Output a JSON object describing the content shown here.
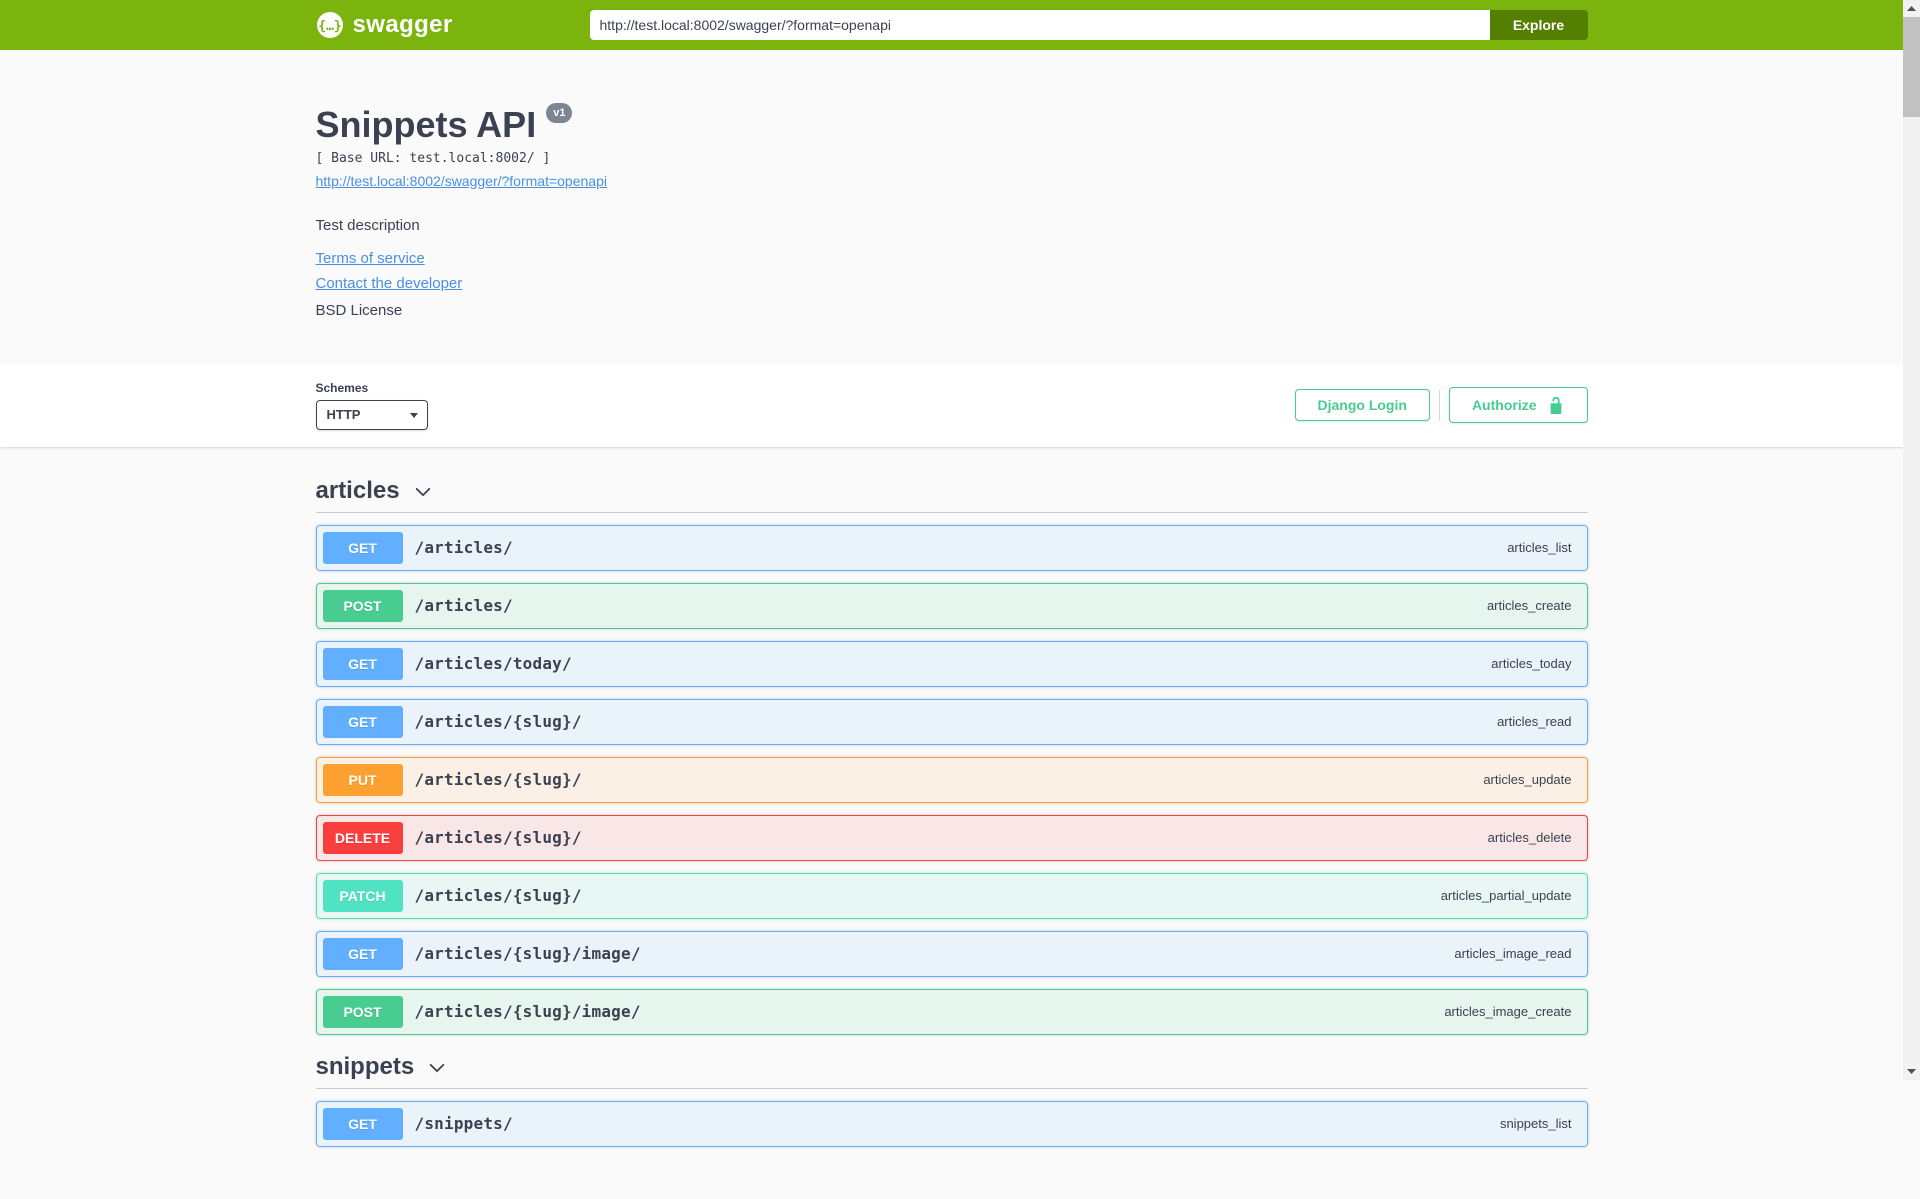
{
  "topbar": {
    "brand": "swagger",
    "url_value": "http://test.local:8002/swagger/?format=openapi",
    "explore_label": "Explore"
  },
  "info": {
    "title": "Snippets API",
    "version_badge": "v1",
    "base_url_label": "[ Base URL: test.local:8002/ ]",
    "spec_link": "http://test.local:8002/swagger/?format=openapi",
    "description": "Test description",
    "terms_link": "Terms of service",
    "contact_link": "Contact the developer",
    "license": "BSD License"
  },
  "scheme": {
    "label": "Schemes",
    "selected": "HTTP",
    "django_login_label": "Django Login",
    "authorize_label": "Authorize"
  },
  "sections": [
    {
      "tag": "articles",
      "operations": [
        {
          "method": "GET",
          "path": "/articles/",
          "op_id": "articles_list"
        },
        {
          "method": "POST",
          "path": "/articles/",
          "op_id": "articles_create"
        },
        {
          "method": "GET",
          "path": "/articles/today/",
          "op_id": "articles_today"
        },
        {
          "method": "GET",
          "path": "/articles/{slug}/",
          "op_id": "articles_read"
        },
        {
          "method": "PUT",
          "path": "/articles/{slug}/",
          "op_id": "articles_update"
        },
        {
          "method": "DELETE",
          "path": "/articles/{slug}/",
          "op_id": "articles_delete"
        },
        {
          "method": "PATCH",
          "path": "/articles/{slug}/",
          "op_id": "articles_partial_update"
        },
        {
          "method": "GET",
          "path": "/articles/{slug}/image/",
          "op_id": "articles_image_read"
        },
        {
          "method": "POST",
          "path": "/articles/{slug}/image/",
          "op_id": "articles_image_create"
        }
      ]
    },
    {
      "tag": "snippets",
      "operations": [
        {
          "method": "GET",
          "path": "/snippets/",
          "op_id": "snippets_list"
        }
      ]
    }
  ],
  "colors": {
    "topbar": "#7ab40c",
    "explore_button": "#547f00",
    "get": "#61affe",
    "post": "#49cc90",
    "put": "#fca130",
    "delete": "#f93e3e",
    "patch": "#50e3c2",
    "authorize": "#49cc90",
    "link": "#4990e2",
    "text": "#3b4151",
    "version_badge_bg": "#7d8492"
  }
}
